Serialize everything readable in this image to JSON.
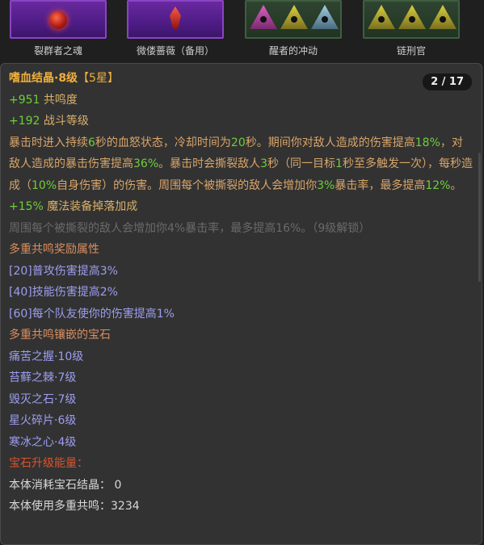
{
  "gems": [
    {
      "label": "裂群者之魂"
    },
    {
      "label": "微偻蔷薇（备用）"
    },
    {
      "label": "醒者的冲动"
    },
    {
      "label": "链刑官"
    }
  ],
  "tooltip": {
    "title": "嗜血结晶·8级",
    "stars": "【5星】",
    "page_indicator": "2 / 17",
    "stat1_value": "+951",
    "stat1_label": " 共鸣度",
    "stat2_value": "+192",
    "stat2_label": " 战斗等级",
    "desc": [
      {
        "t": "暴击时进入持续",
        "c": "body"
      },
      {
        "t": "6",
        "c": "num"
      },
      {
        "t": "秒的血怒状态，冷却时间为",
        "c": "body"
      },
      {
        "t": "20",
        "c": "num"
      },
      {
        "t": "秒。期间你对敌人造成的伤害提高",
        "c": "body"
      },
      {
        "t": "18%",
        "c": "num"
      },
      {
        "t": "，对敌人造成的暴击伤害提高",
        "c": "body"
      },
      {
        "t": "36%",
        "c": "num"
      },
      {
        "t": "。暴击时会撕裂敌人",
        "c": "body"
      },
      {
        "t": "3",
        "c": "num"
      },
      {
        "t": "秒（同一目标",
        "c": "body"
      },
      {
        "t": "1",
        "c": "num"
      },
      {
        "t": "秒至多触发一次），每秒造成（",
        "c": "body"
      },
      {
        "t": "10%",
        "c": "num"
      },
      {
        "t": "自身伤害）的伤害。周围每个被撕裂的敌人会增加你",
        "c": "body"
      },
      {
        "t": "3%",
        "c": "num"
      },
      {
        "t": "暴击率，最多提高",
        "c": "body"
      },
      {
        "t": "12%",
        "c": "num"
      },
      {
        "t": "。",
        "c": "body"
      }
    ],
    "bonus_value": "+15%",
    "bonus_label": " 魔法装备掉落加成",
    "locked_text": "周围每个被撕裂的敌人会增加你4%暴击率，最多提高16%。（9级解锁）",
    "resonance_header": "多重共鸣奖励属性",
    "resonance_items": [
      "[20]普攻伤害提高3%",
      "[40]技能伤害提高2%",
      "[60]每个队友使你的伤害提高1%"
    ],
    "socket_header": "多重共鸣镶嵌的宝石",
    "socket_items": [
      "痛苦之握·10级",
      "苔藓之棘·7级",
      "毁灭之石·7级",
      "星火碎片·6级",
      "寒冰之心·4级"
    ],
    "upgrade_header": "宝石升级能量：",
    "upgrade_line1": "本体消耗宝石结晶： 0",
    "upgrade_line2": "本体使用多重共鸣：3234"
  }
}
